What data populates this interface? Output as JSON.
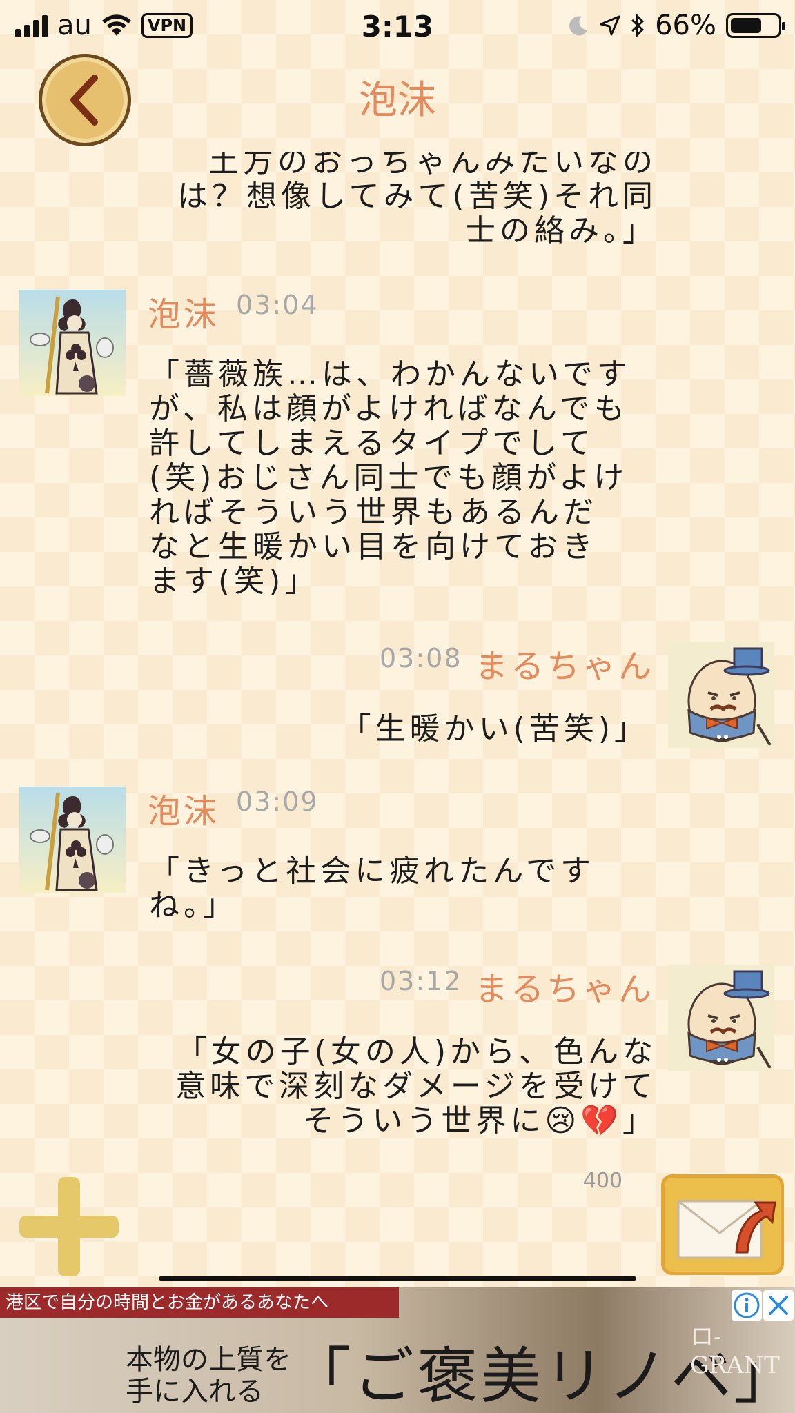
{
  "status_bar": {
    "carrier": "au",
    "vpn": "VPN",
    "time": "3:13",
    "battery_percent": "66%",
    "battery_level": 0.66
  },
  "header": {
    "title": "泡沫"
  },
  "messages": {
    "partial_top": {
      "text": "土方のおっちゃんみたいなの\nは？想像してみて(苦笑)それ同\n士の絡み。」"
    },
    "m1": {
      "name": "泡沫",
      "time": "03:04",
      "text": "「薔薇族…は、わかんないです\nが、私は顔がよければなんでも\n許してしまえるタイプでして\n(笑)おじさん同士でも顔がよけ\nればそういう世界もあるんだ\nなと生暖かい目を向けておき\nます(笑)」"
    },
    "m2": {
      "name": "まるちゃん",
      "time": "03:08",
      "text": "「生暖かい(苦笑)」"
    },
    "m3": {
      "name": "泡沫",
      "time": "03:09",
      "text": "「きっと社会に疲れたんです\nね。」"
    },
    "m4": {
      "name": "まるちゃん",
      "time": "03:12",
      "text": "「女の子(女の人)から、色んな\n意味で深刻なダメージを受けて\nそういう世界に😢💔」"
    }
  },
  "composer": {
    "char_count": "400"
  },
  "ad": {
    "top_strip": "港区で自分の時間とお金があるあなたへ",
    "line1": "本物の上質を",
    "line2": "手に入れる",
    "headline": "「ご褒美リノベ」",
    "brand": "ロ-GRANT"
  },
  "colors": {
    "accent": "#e58a5d",
    "gold": "#e6c06e",
    "background": "#fdf3df"
  }
}
